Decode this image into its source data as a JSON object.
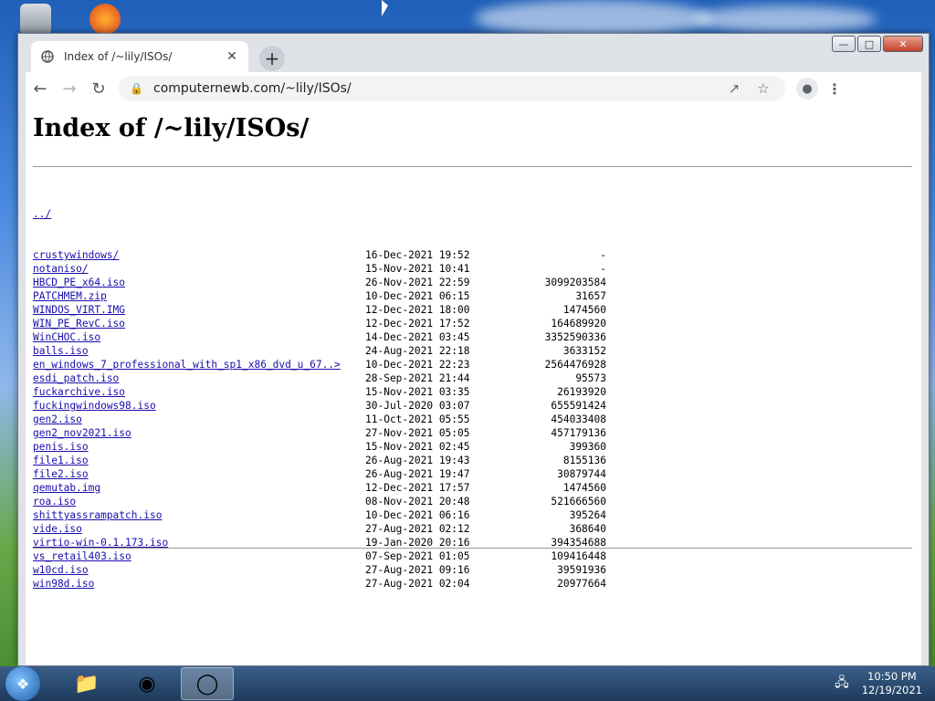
{
  "browser": {
    "tab_title": "Index of /~lily/ISOs/",
    "url": "computernewb.com/~lily/ISOs/"
  },
  "page": {
    "heading": "Index of /~lily/ISOs/",
    "parent_link": "../",
    "entries": [
      {
        "name": "crustywindows/",
        "date": "16-Dec-2021 19:52",
        "size": "-"
      },
      {
        "name": "notaniso/",
        "date": "15-Nov-2021 10:41",
        "size": "-"
      },
      {
        "name": "HBCD_PE_x64.iso",
        "date": "26-Nov-2021 22:59",
        "size": "3099203584"
      },
      {
        "name": "PATCHMEM.zip",
        "date": "10-Dec-2021 06:15",
        "size": "31657"
      },
      {
        "name": "WINDOS_VIRT.IMG",
        "date": "12-Dec-2021 18:00",
        "size": "1474560"
      },
      {
        "name": "WIN_PE_RevC.iso",
        "date": "12-Dec-2021 17:52",
        "size": "164689920"
      },
      {
        "name": "WinCHOC.iso",
        "date": "14-Dec-2021 03:45",
        "size": "3352590336"
      },
      {
        "name": "balls.iso",
        "date": "24-Aug-2021 22:18",
        "size": "3633152"
      },
      {
        "name": "en_windows_7_professional_with_sp1_x86_dvd_u_67..>",
        "date": "10-Dec-2021 22:23",
        "size": "2564476928"
      },
      {
        "name": "esdi_patch.iso",
        "date": "28-Sep-2021 21:44",
        "size": "95573"
      },
      {
        "name": "fuckarchive.iso",
        "date": "15-Nov-2021 03:35",
        "size": "26193920"
      },
      {
        "name": "fuckingwindows98.iso",
        "date": "30-Jul-2020 03:07",
        "size": "655591424"
      },
      {
        "name": "gen2.iso",
        "date": "11-Oct-2021 05:55",
        "size": "454033408"
      },
      {
        "name": "gen2_nov2021.iso",
        "date": "27-Nov-2021 05:05",
        "size": "457179136"
      },
      {
        "name": "penis.iso",
        "date": "15-Nov-2021 02:45",
        "size": "399360"
      },
      {
        "name": "file1.iso",
        "date": "26-Aug-2021 19:43",
        "size": "8155136"
      },
      {
        "name": "file2.iso",
        "date": "26-Aug-2021 19:47",
        "size": "30879744"
      },
      {
        "name": "qemutab.img",
        "date": "12-Dec-2021 17:57",
        "size": "1474560"
      },
      {
        "name": "roa.iso",
        "date": "08-Nov-2021 20:48",
        "size": "521666560"
      },
      {
        "name": "shittyassrampatch.iso",
        "date": "10-Dec-2021 06:16",
        "size": "395264"
      },
      {
        "name": "vide.iso",
        "date": "27-Aug-2021 02:12",
        "size": "368640"
      },
      {
        "name": "virtio-win-0.1.173.iso",
        "date": "19-Jan-2020 20:16",
        "size": "394354688"
      },
      {
        "name": "vs_retail403.iso",
        "date": "07-Sep-2021 01:05",
        "size": "109416448"
      },
      {
        "name": "w10cd.iso",
        "date": "27-Aug-2021 09:16",
        "size": "39591936"
      },
      {
        "name": "win98d.iso",
        "date": "27-Aug-2021 02:04",
        "size": "20977664"
      }
    ]
  },
  "taskbar": {
    "time": "10:50 PM",
    "date": "12/19/2021"
  }
}
